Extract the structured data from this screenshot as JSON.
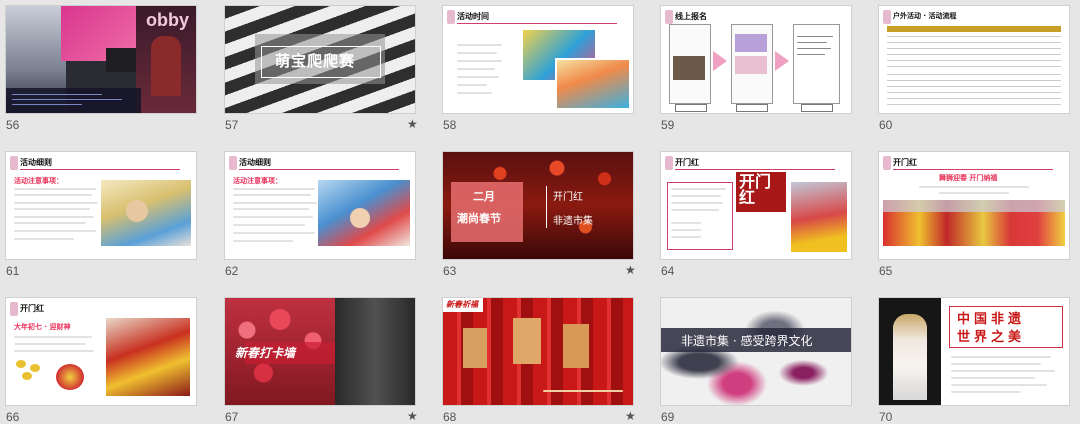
{
  "slides": [
    {
      "num": "56",
      "starred": false,
      "text": "obby"
    },
    {
      "num": "57",
      "starred": true,
      "title": "萌宝爬爬赛"
    },
    {
      "num": "58",
      "starred": false,
      "heading": "活动时间"
    },
    {
      "num": "59",
      "starred": false,
      "heading": "线上报名"
    },
    {
      "num": "60",
      "starred": false,
      "heading": "户外活动 · 活动流程"
    },
    {
      "num": "61",
      "starred": false,
      "heading": "活动细则",
      "subheading": "活动注意事项："
    },
    {
      "num": "62",
      "starred": false,
      "heading": "活动细则",
      "subheading": "活动注意事项："
    },
    {
      "num": "63",
      "starred": true,
      "month": "二月",
      "theme": "潮尚春节",
      "item1": "开门红",
      "item2": "非遗市集"
    },
    {
      "num": "64",
      "starred": false,
      "heading": "开门红",
      "calligraphy": "开门红"
    },
    {
      "num": "65",
      "starred": false,
      "heading": "开门红",
      "subtitle": "舞狮迎春 开门纳福"
    },
    {
      "num": "66",
      "starred": false,
      "heading": "开门红",
      "subtitle": "大年初七 · 迎财神"
    },
    {
      "num": "67",
      "starred": true,
      "title": "新春打卡墙"
    },
    {
      "num": "68",
      "starred": true,
      "heading": "新春祈福"
    },
    {
      "num": "69",
      "starred": false,
      "title": "非遗市集 · 感受跨界文化"
    },
    {
      "num": "70",
      "starred": false,
      "title_line1": "中国非遗",
      "title_line2": "世界之美"
    }
  ],
  "star_glyph": "★"
}
